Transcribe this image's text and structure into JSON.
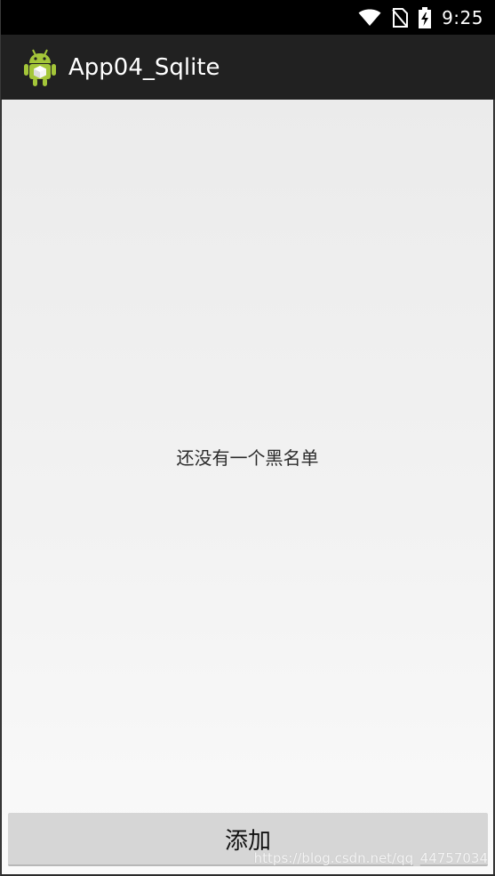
{
  "status_bar": {
    "time": "9:25",
    "icons": [
      "wifi-icon",
      "no-sim-icon",
      "battery-charging-icon"
    ]
  },
  "action_bar": {
    "app_icon": "android-app-icon",
    "title": "App04_Sqlite"
  },
  "main": {
    "empty_message": "还没有一个黑名单"
  },
  "footer": {
    "add_button_label": "添加"
  },
  "watermark": "https://blog.csdn.net/qq_44757034",
  "colors": {
    "status_bar_bg": "#000000",
    "action_bar_bg": "#212121",
    "content_bg": "#f0f0f0",
    "button_bg": "#d6d6d6"
  }
}
